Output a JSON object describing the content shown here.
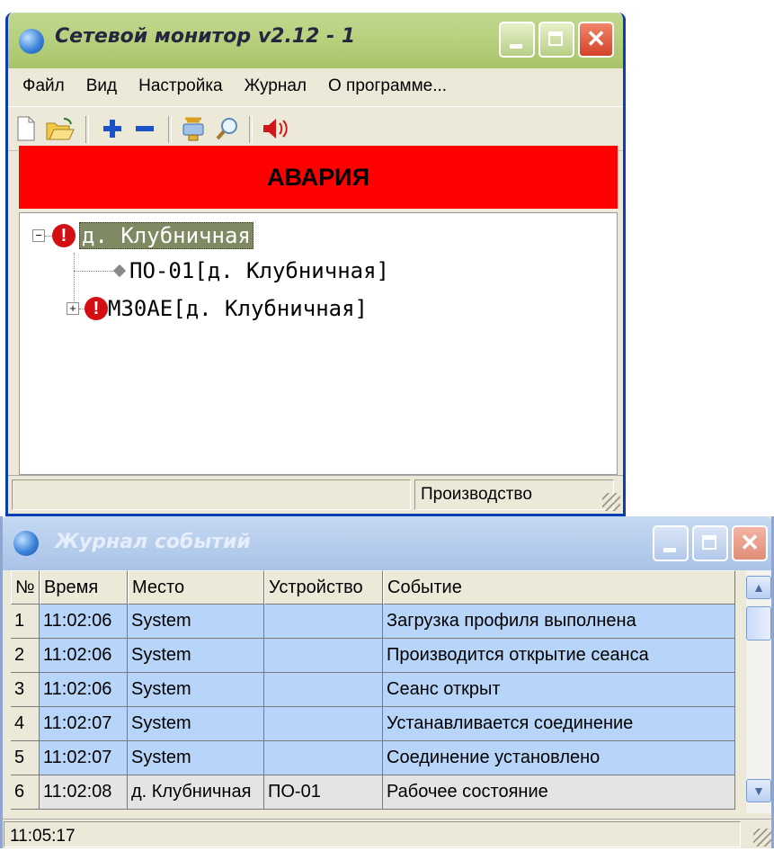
{
  "main_window": {
    "title": "Сетевой монитор v2.12  -  1",
    "menu": [
      "Файл",
      "Вид",
      "Настройка",
      "Журнал",
      "О программе..."
    ],
    "toolbar_icons": [
      "new-file-icon",
      "open-folder-icon",
      "add-icon",
      "remove-icon",
      "network-icon",
      "search-icon",
      "speaker-icon"
    ],
    "alarm_text": "АВАРИЯ",
    "alarm_color": "#ff0000",
    "tree": {
      "root": {
        "expander": "⊟",
        "label": "д. Клубничная"
      },
      "children": [
        {
          "expander": "",
          "label": "ПО-01[д. Клубничная]"
        },
        {
          "expander": "⊞",
          "label": "М30АЕ[д. Клубничная]"
        }
      ]
    },
    "status": {
      "left": "",
      "right": "Производство"
    }
  },
  "journal_window": {
    "title": "Журнал событий",
    "columns": [
      "№",
      "Время",
      "Место",
      "Устройство",
      "Событие"
    ],
    "rows": [
      {
        "n": "1",
        "time": "11:02:06",
        "place": "System",
        "device": "",
        "event": "Загрузка профиля выполнена"
      },
      {
        "n": "2",
        "time": "11:02:06",
        "place": "System",
        "device": "",
        "event": "Производится открытие сеанса"
      },
      {
        "n": "3",
        "time": "11:02:06",
        "place": "System",
        "device": "",
        "event": "Сеанс открыт"
      },
      {
        "n": "4",
        "time": "11:02:07",
        "place": "System",
        "device": "",
        "event": "Устанавливается соединение"
      },
      {
        "n": "5",
        "time": "11:02:07",
        "place": "System",
        "device": "",
        "event": "Соединение установлено"
      },
      {
        "n": "6",
        "time": "11:02:08",
        "place": "д. Клубничная",
        "device": "ПО-01",
        "event": "Рабочее состояние"
      }
    ],
    "status_time": "11:05:17",
    "row_colors": {
      "ok": "#b7d5f8",
      "gray": "#e4e4e4"
    }
  }
}
